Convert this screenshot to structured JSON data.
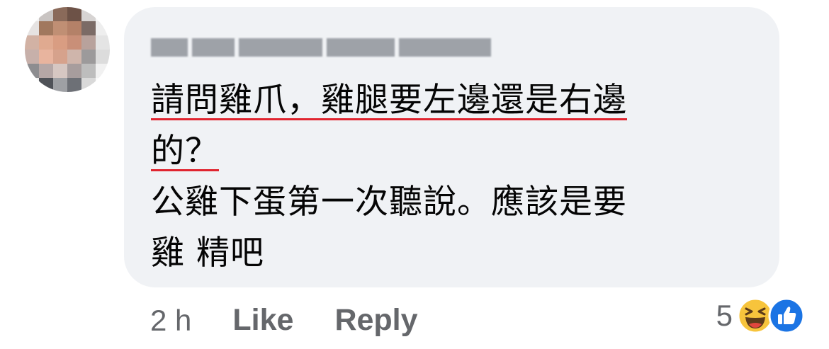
{
  "comment": {
    "author_name_blurred": true,
    "text_lines": [
      {
        "text": "請問雞爪，雞腿要左邊還是右邊",
        "underlined": true
      },
      {
        "text": "的？",
        "underlined": true
      },
      {
        "text": "公雞下蛋第一次聽說。應該是要",
        "underlined": false
      },
      {
        "text": "雞 精吧",
        "underlined": false
      }
    ],
    "timestamp": "2 h",
    "like_label": "Like",
    "reply_label": "Reply",
    "reaction_count": "5",
    "reactions": [
      "haha-icon",
      "like-icon"
    ]
  },
  "colors": {
    "bubble": "#f0f2f5",
    "underline": "#e0242f",
    "meta_text": "#65676b",
    "like_blue": "#1b74e4",
    "haha_yellow": "#f7c43c"
  }
}
